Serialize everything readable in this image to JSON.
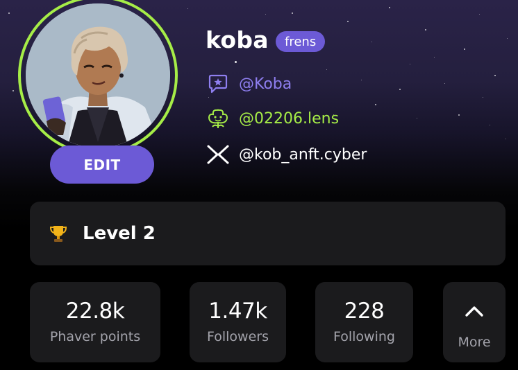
{
  "profile": {
    "username": "koba",
    "badge": "frens",
    "edit_label": "EDIT",
    "avatar_alt": "avatar",
    "ring_color": "#a6ed47",
    "accent_color": "#6c5ad6"
  },
  "handles": [
    {
      "icon": "chat-star-icon",
      "text": "@Koba",
      "color": "#8f7ff0"
    },
    {
      "icon": "lens-icon",
      "text": "@02206.lens",
      "color": "#a6ed47"
    },
    {
      "icon": "cyberconnect-icon",
      "text": "@kob_anft.cyber",
      "color": "#ffffff"
    }
  ],
  "level": {
    "icon": "trophy-icon",
    "label": "Level 2"
  },
  "stats": [
    {
      "value": "22.8k",
      "label": "Phaver points"
    },
    {
      "value": "1.47k",
      "label": "Followers"
    },
    {
      "value": "228",
      "label": "Following"
    }
  ],
  "more": {
    "label": "More",
    "icon": "chevron-up-icon"
  }
}
